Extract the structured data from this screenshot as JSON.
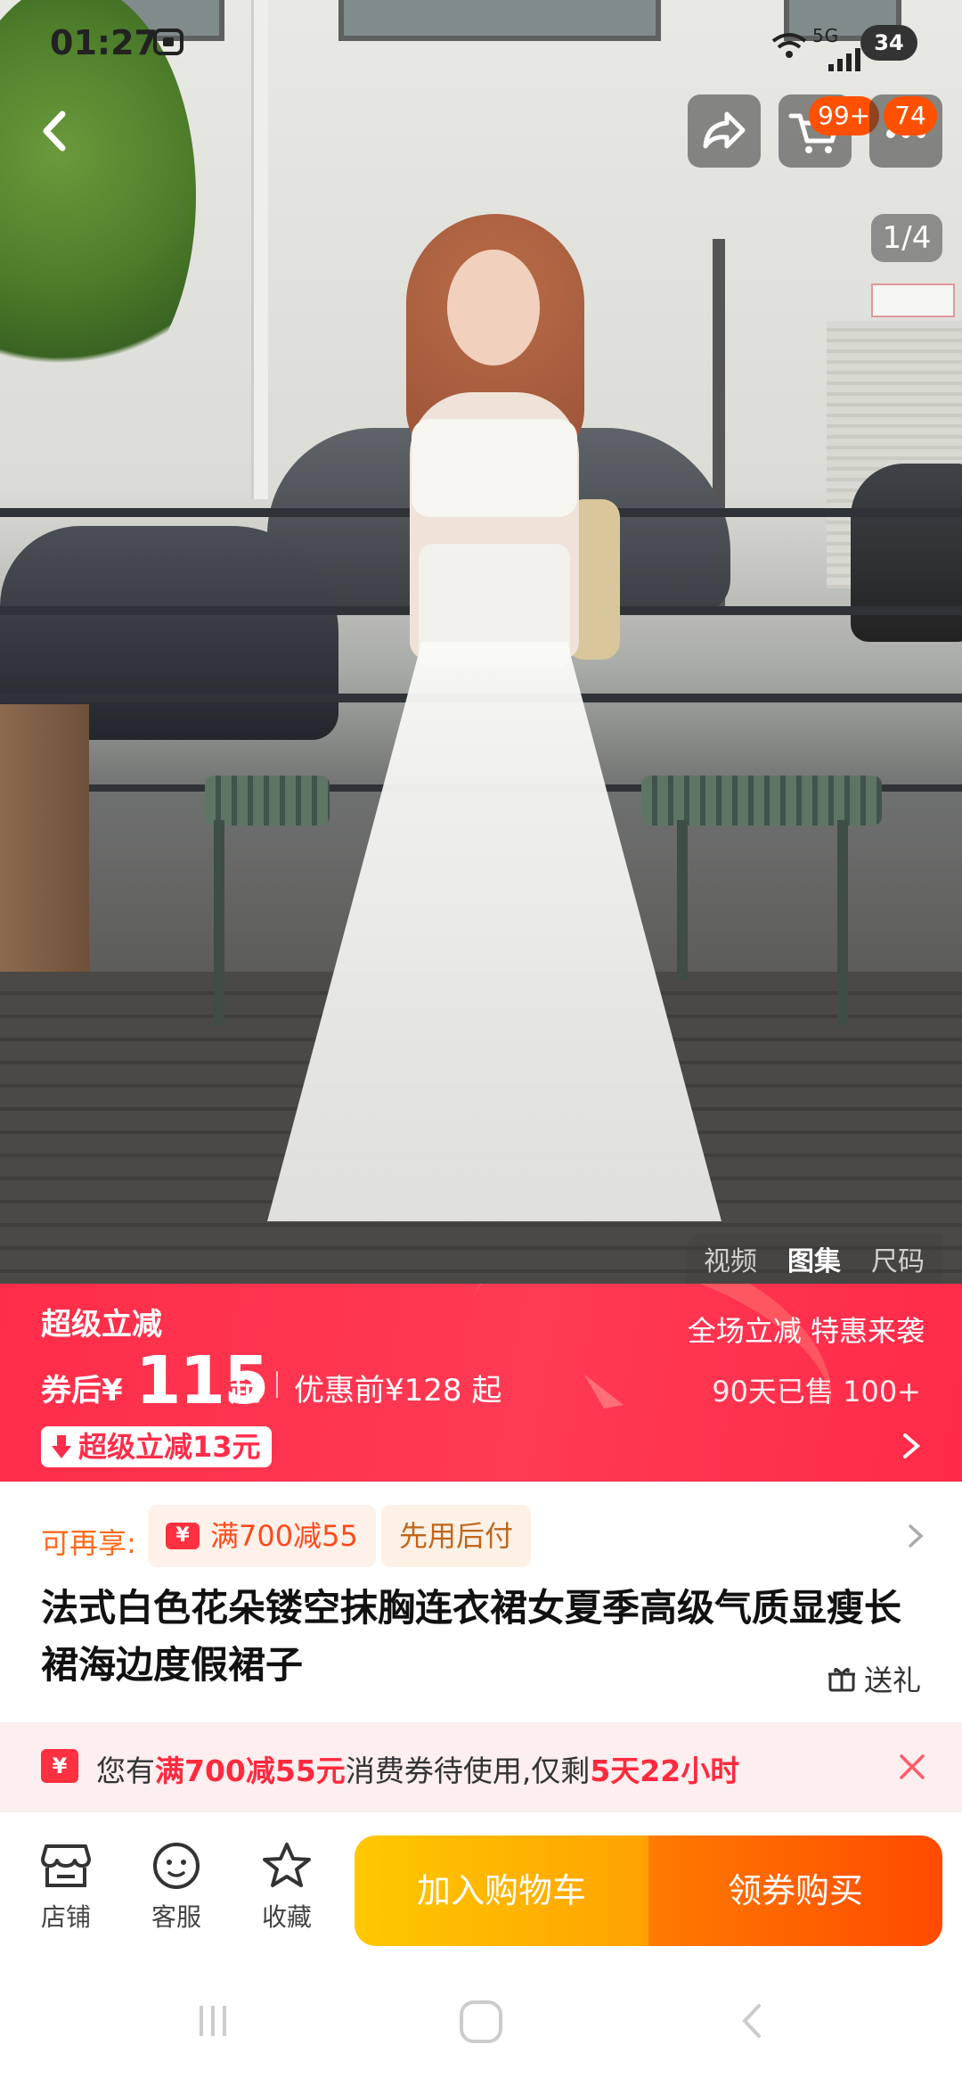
{
  "status_bar": {
    "time": "01:27",
    "network": "5G",
    "battery": "34"
  },
  "top_actions": {
    "cart_badge": "99+",
    "message_badge": "74"
  },
  "gallery": {
    "page_indicator": "1/4",
    "tabs": [
      "视频",
      "图集",
      "尺码"
    ],
    "active_tab": "图集"
  },
  "price_banner": {
    "title": "超级立减",
    "after_coupon_label": "券后",
    "currency": "¥",
    "price": "115",
    "price_suffix": "起",
    "before_discount": "优惠前¥128 起",
    "promo_right": "全场立减 特惠来袭",
    "sold": "90天已售 100+",
    "tag": "超级立减13元"
  },
  "benefits": {
    "label": "可再享:",
    "coupon_chip": "满700减55",
    "pay_later_chip": "先用后付"
  },
  "product": {
    "title": "法式白色花朵镂空抹胸连衣裙女夏季高级气质显瘦长裙海边度假裙子",
    "gift_label": "送礼"
  },
  "coupon_notice": {
    "prefix": "您有",
    "highlight1": "满700减55元",
    "middle": "消费券待使用,仅剩",
    "highlight2": "5天22小时"
  },
  "action_bar": {
    "shop": "店铺",
    "service": "客服",
    "favorite": "收藏",
    "add_to_cart": "加入购物车",
    "buy": "领券购买"
  },
  "colors": {
    "brand_red": "#ff2d4a",
    "orange": "#ff5000",
    "yellow": "#ffc800"
  },
  "icons": [
    "back-arrow-icon",
    "share-icon",
    "cart-icon",
    "more-icon",
    "yen-coupon-icon",
    "gift-icon",
    "close-icon",
    "store-icon",
    "service-icon",
    "star-icon"
  ]
}
